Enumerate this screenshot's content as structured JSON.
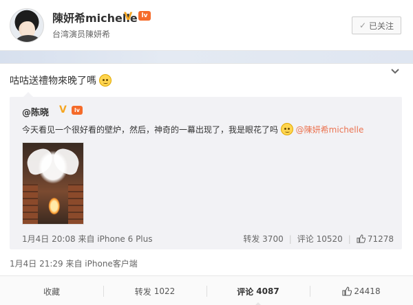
{
  "profile": {
    "name": "陳妍希michelle",
    "vip_mark": "V",
    "level_badge": "lv",
    "description": "台湾演员陳妍希",
    "follow_label": "已关注"
  },
  "post": {
    "text": "咕咕送禮物來晚了嗎",
    "meta": "1月4日 21:29 来自 iPhone客户端",
    "repost": {
      "user": "@陈晓",
      "vip_mark": "V",
      "level_badge": "lv",
      "text": "今天看见一个很好看的壁炉，然后，神奇的一幕出现了，我是眼花了吗",
      "mention": "@陳妍希michelle",
      "meta": "1月4日 20:08 来自 iPhone 6 Plus",
      "forward": "转发 3700",
      "comment": "评论 10520",
      "likes": "71278"
    }
  },
  "actions": {
    "collect": "收藏",
    "forward_label": "转发",
    "forward_count": "1022",
    "comment_label": "评论",
    "comment_count": "4087",
    "likes": "24418"
  },
  "colors": {
    "mention": "#eb7350",
    "vip": "#f5a623",
    "level": "#f56b2a"
  }
}
